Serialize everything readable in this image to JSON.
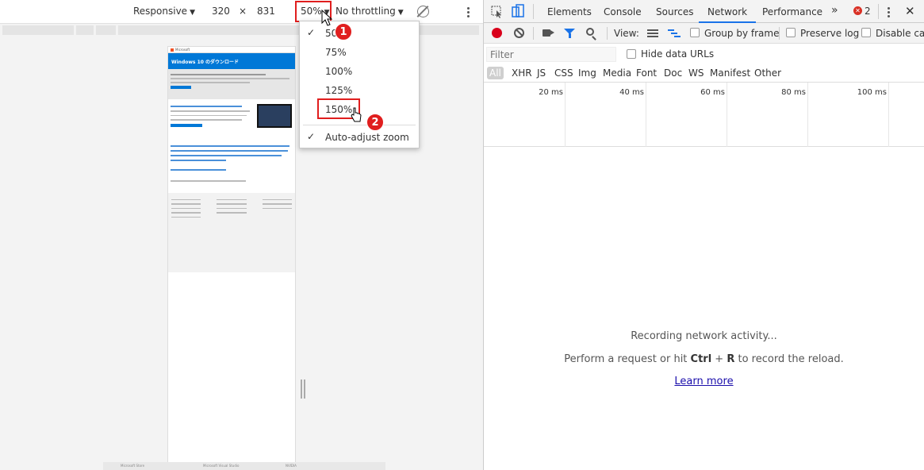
{
  "device_toolbar": {
    "device": "Responsive",
    "width": "320",
    "times": "×",
    "height": "831",
    "zoom": "50%",
    "throttling": "No throttling"
  },
  "zoom_menu": {
    "items": [
      {
        "label": "50%",
        "checked": true
      },
      {
        "label": "75%",
        "checked": false
      },
      {
        "label": "100%",
        "checked": false
      },
      {
        "label": "125%",
        "checked": false
      },
      {
        "label": "150%",
        "checked": false
      }
    ],
    "auto_adjust": {
      "label": "Auto-adjust zoom",
      "checked": true
    }
  },
  "markers": {
    "first": "1",
    "second": "2"
  },
  "mini_page": {
    "brand": "Microsoft",
    "hero_title": "Windows 10 のダウンロード",
    "footer": [
      "Microsoft Store",
      "Microsoft Visual Studio",
      "NVIDIA"
    ]
  },
  "devtools": {
    "tabs": [
      "Elements",
      "Console",
      "Sources",
      "Network",
      "Performance"
    ],
    "active_tab": "Network",
    "more": "»",
    "error_badge": "✕",
    "error_count": "2",
    "close": "✕",
    "toolbar": {
      "view_label": "View:",
      "group_by_frame": "Group by frame",
      "preserve_log": "Preserve log",
      "disable_cache": "Disable cac"
    },
    "filter_placeholder": "Filter",
    "hide_data_urls": "Hide data URLs",
    "types": [
      "All",
      "XHR",
      "JS",
      "CSS",
      "Img",
      "Media",
      "Font",
      "Doc",
      "WS",
      "Manifest",
      "Other"
    ],
    "timeline_labels": [
      "20 ms",
      "40 ms",
      "60 ms",
      "80 ms",
      "100 ms"
    ],
    "empty_title": "Recording network activity...",
    "empty_hint_prefix": "Perform a request or hit ",
    "empty_hint_key1": "Ctrl",
    "empty_hint_plus": " + ",
    "empty_hint_key2": "R",
    "empty_hint_suffix": " to record the reload.",
    "learn_more": "Learn more"
  },
  "colors": {
    "accent": "#1a73e8",
    "highlight": "#e01e1e",
    "record": "#d9001b"
  }
}
